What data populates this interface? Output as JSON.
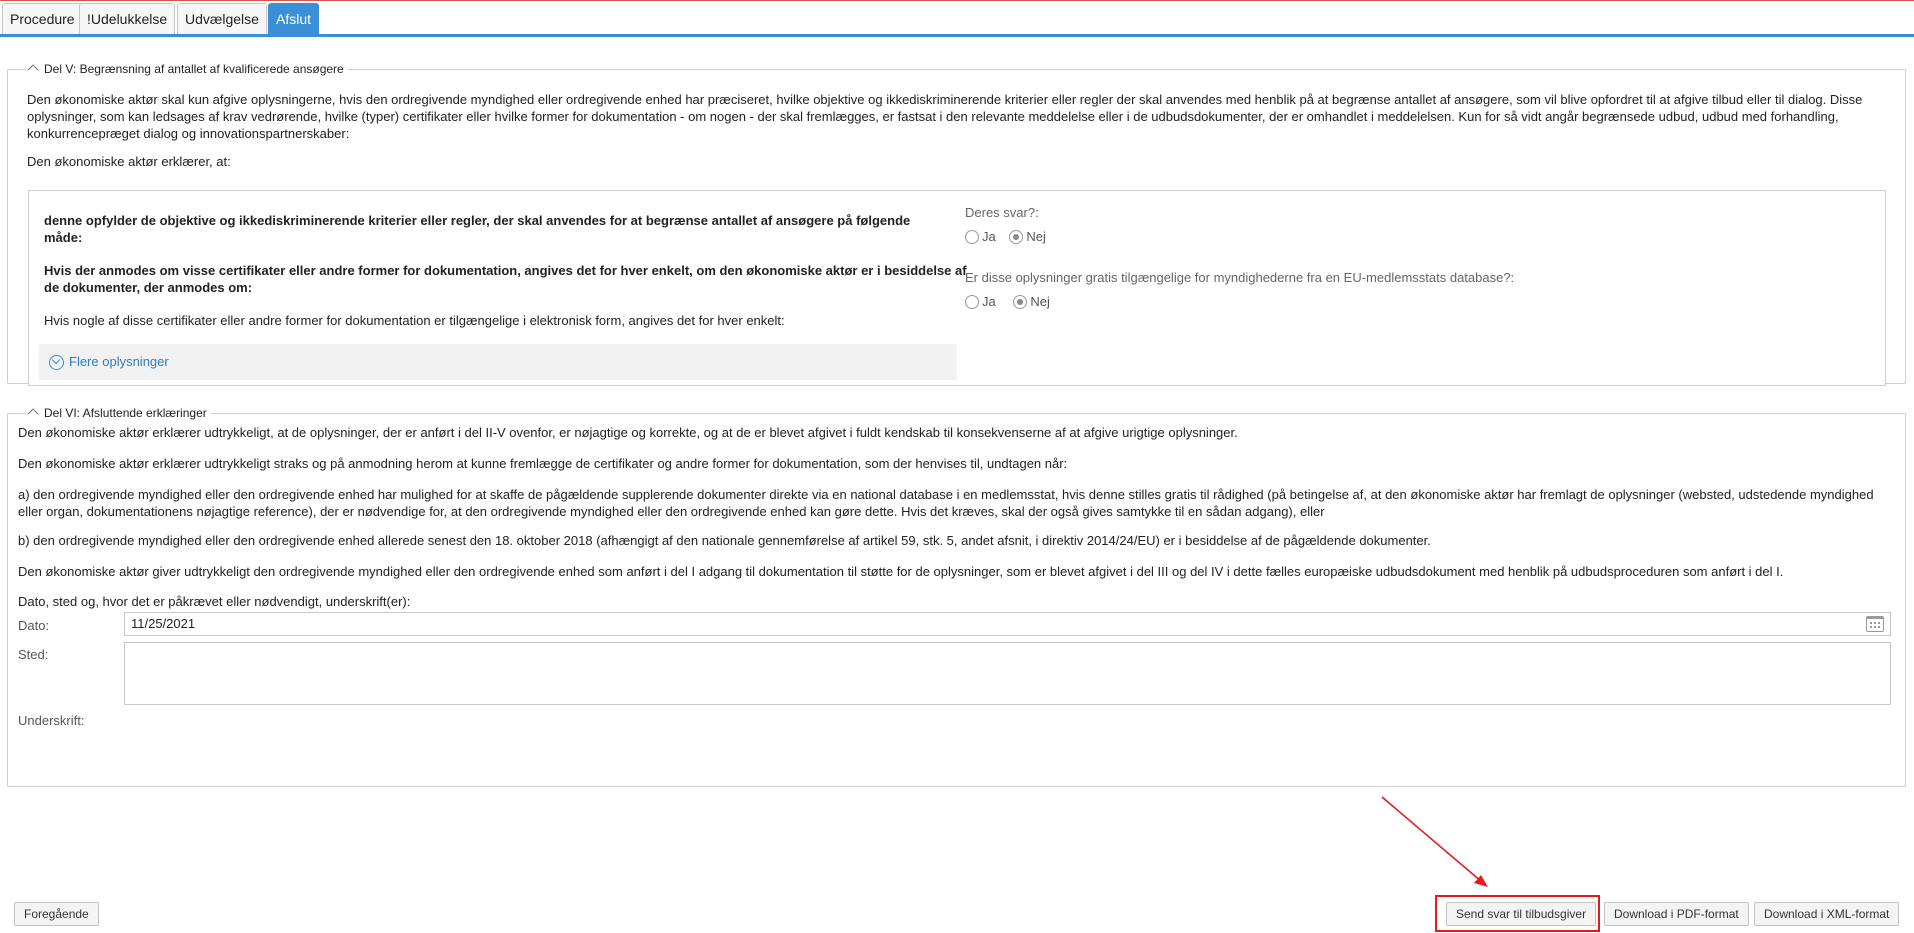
{
  "tabs": [
    {
      "label": "Procedure",
      "active": false
    },
    {
      "label": "!Udelukkelse",
      "active": false
    },
    {
      "label": "Udvælgelse",
      "active": false
    },
    {
      "label": "Afslut",
      "active": true
    }
  ],
  "section5": {
    "legend": "Del V: Begrænsning af antallet af kvalificerede ansøgere",
    "intro": "Den økonomiske aktør skal kun afgive oplysningerne, hvis den ordregivende myndighed eller ordregivende enhed har præciseret, hvilke objektive og ikkediskriminerende kriterier eller regler der skal anvendes med henblik på at begrænse antallet af ansøgere, som vil blive opfordret til at afgive tilbud eller til dialog. Disse oplysninger, som kan ledsages af krav vedrørende, hvilke (typer) certifikater eller hvilke former for dokumentation - om nogen - der skal fremlægges, er fastsat i den relevante meddelelse eller i de udbudsdokumenter, der er omhandlet i meddelelsen. Kun for så vidt angår begrænsede udbud, udbud med forhandling, konkurrencepræget dialog og innovationspartnerskaber:",
    "declares": "Den økonomiske aktør erklærer, at:",
    "criteria_text": "denne opfylder de objektive og ikkediskriminerende kriterier eller regler, der skal anvendes for at begrænse antallet af ansøgere på følgende måde:",
    "certificates_text": "Hvis der anmodes om visse certifikater eller andre former for dokumentation, angives det for hver enkelt, om den økonomiske aktør er i besiddelse af de dokumenter, der anmodes om:",
    "electronic_text": "Hvis nogle af disse certifikater eller andre former for dokumentation er tilgængelige i elektronisk form, angives det for hver enkelt:",
    "more_info": "Flere oplysninger",
    "q1": {
      "label": "Deres svar?:",
      "yes": "Ja",
      "no": "Nej",
      "selected": "no"
    },
    "q2": {
      "label": "Er disse oplysninger gratis tilgængelige for myndighederne fra en EU-medlemsstats database?:",
      "yes": "Ja",
      "no": "Nej",
      "selected": "no"
    }
  },
  "section6": {
    "legend": "Del VI: Afsluttende erklæringer",
    "p1": "Den økonomiske aktør erklærer udtrykkeligt, at de oplysninger, der er anført i del II-V ovenfor, er nøjagtige og korrekte, og at de er blevet afgivet i fuldt kendskab til konsekvenserne af at afgive urigtige oplysninger.",
    "p2": "Den økonomiske aktør erklærer udtrykkeligt straks og på anmodning herom at kunne fremlægge de certifikater og andre former for dokumentation, som der henvises til, undtagen når:",
    "p3": "a) den ordregivende myndighed eller den ordregivende enhed har mulighed for at skaffe de pågældende supplerende dokumenter direkte via en national database i en medlemsstat, hvis denne stilles gratis til rådighed (på betingelse af, at den økonomiske aktør har fremlagt de oplysninger (websted, udstedende myndighed eller organ, dokumentationens nøjagtige reference), der er nødvendige for, at den ordregivende myndighed eller den ordregivende enhed kan gøre dette. Hvis det kræves, skal der også gives samtykke til en sådan adgang), eller",
    "p4": "b) den ordregivende myndighed eller den ordregivende enhed allerede senest den 18. oktober 2018 (afhængigt af den nationale gennemførelse af artikel 59, stk. 5, andet afsnit, i direktiv 2014/24/EU) er i besiddelse af de pågældende dokumenter.",
    "p5": "Den økonomiske aktør giver udtrykkeligt den ordregivende myndighed eller den ordregivende enhed som anført i del I adgang til dokumentation til støtte for de oplysninger, som er blevet afgivet i del III og del IV i dette fælles europæiske udbudsdokument med henblik på udbudsproceduren som anført i del I.",
    "p6": "Dato, sted og, hvor det er påkrævet eller nødvendigt, underskrift(er):",
    "date_label": "Dato:",
    "date_value": "11/25/2021",
    "place_label": "Sted:",
    "place_value": "",
    "signature_label": "Underskrift:"
  },
  "footer": {
    "previous": "Foregående",
    "send": "Send svar til tilbudsgiver",
    "pdf": "Download i PDF-format",
    "xml": "Download i XML-format"
  },
  "colors": {
    "accent": "#3a8fd6",
    "annotation": "#e31b1b"
  }
}
